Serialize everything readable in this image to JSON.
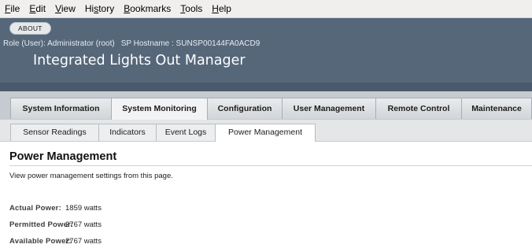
{
  "menubar": {
    "items": [
      {
        "label": "File",
        "underline": "F"
      },
      {
        "label": "Edit",
        "underline": "E"
      },
      {
        "label": "View",
        "underline": "V"
      },
      {
        "label": "History",
        "underline": "s"
      },
      {
        "label": "Bookmarks",
        "underline": "B"
      },
      {
        "label": "Tools",
        "underline": "T"
      },
      {
        "label": "Help",
        "underline": "H"
      }
    ]
  },
  "header": {
    "about_label": "ABOUT",
    "role": "Role (User): Administrator (root)",
    "hostname": "SP Hostname : SUNSP00144FA0ACD9",
    "app_title": "Integrated Lights Out Manager"
  },
  "main_tabs": [
    {
      "label": "System Information",
      "active": false
    },
    {
      "label": "System Monitoring",
      "active": true
    },
    {
      "label": "Configuration",
      "active": false
    },
    {
      "label": "User Management",
      "active": false
    },
    {
      "label": "Remote Control",
      "active": false
    },
    {
      "label": "Maintenance",
      "active": false
    }
  ],
  "sub_tabs": [
    {
      "label": "Sensor Readings",
      "active": false
    },
    {
      "label": "Indicators",
      "active": false
    },
    {
      "label": "Event Logs",
      "active": false
    },
    {
      "label": "Power Management",
      "active": true
    }
  ],
  "content": {
    "title": "Power Management",
    "description": "View power management settings from this page.",
    "fields": [
      {
        "label": "Actual Power:",
        "value": "1859 watts"
      },
      {
        "label": "Permitted Power:",
        "value": "2767 watts"
      },
      {
        "label": "Available Power:",
        "value": "2767 watts"
      }
    ]
  },
  "colors": {
    "banner": "#56677a",
    "menubar": "#f0efee",
    "tab_bar": "#c6cbd1"
  }
}
